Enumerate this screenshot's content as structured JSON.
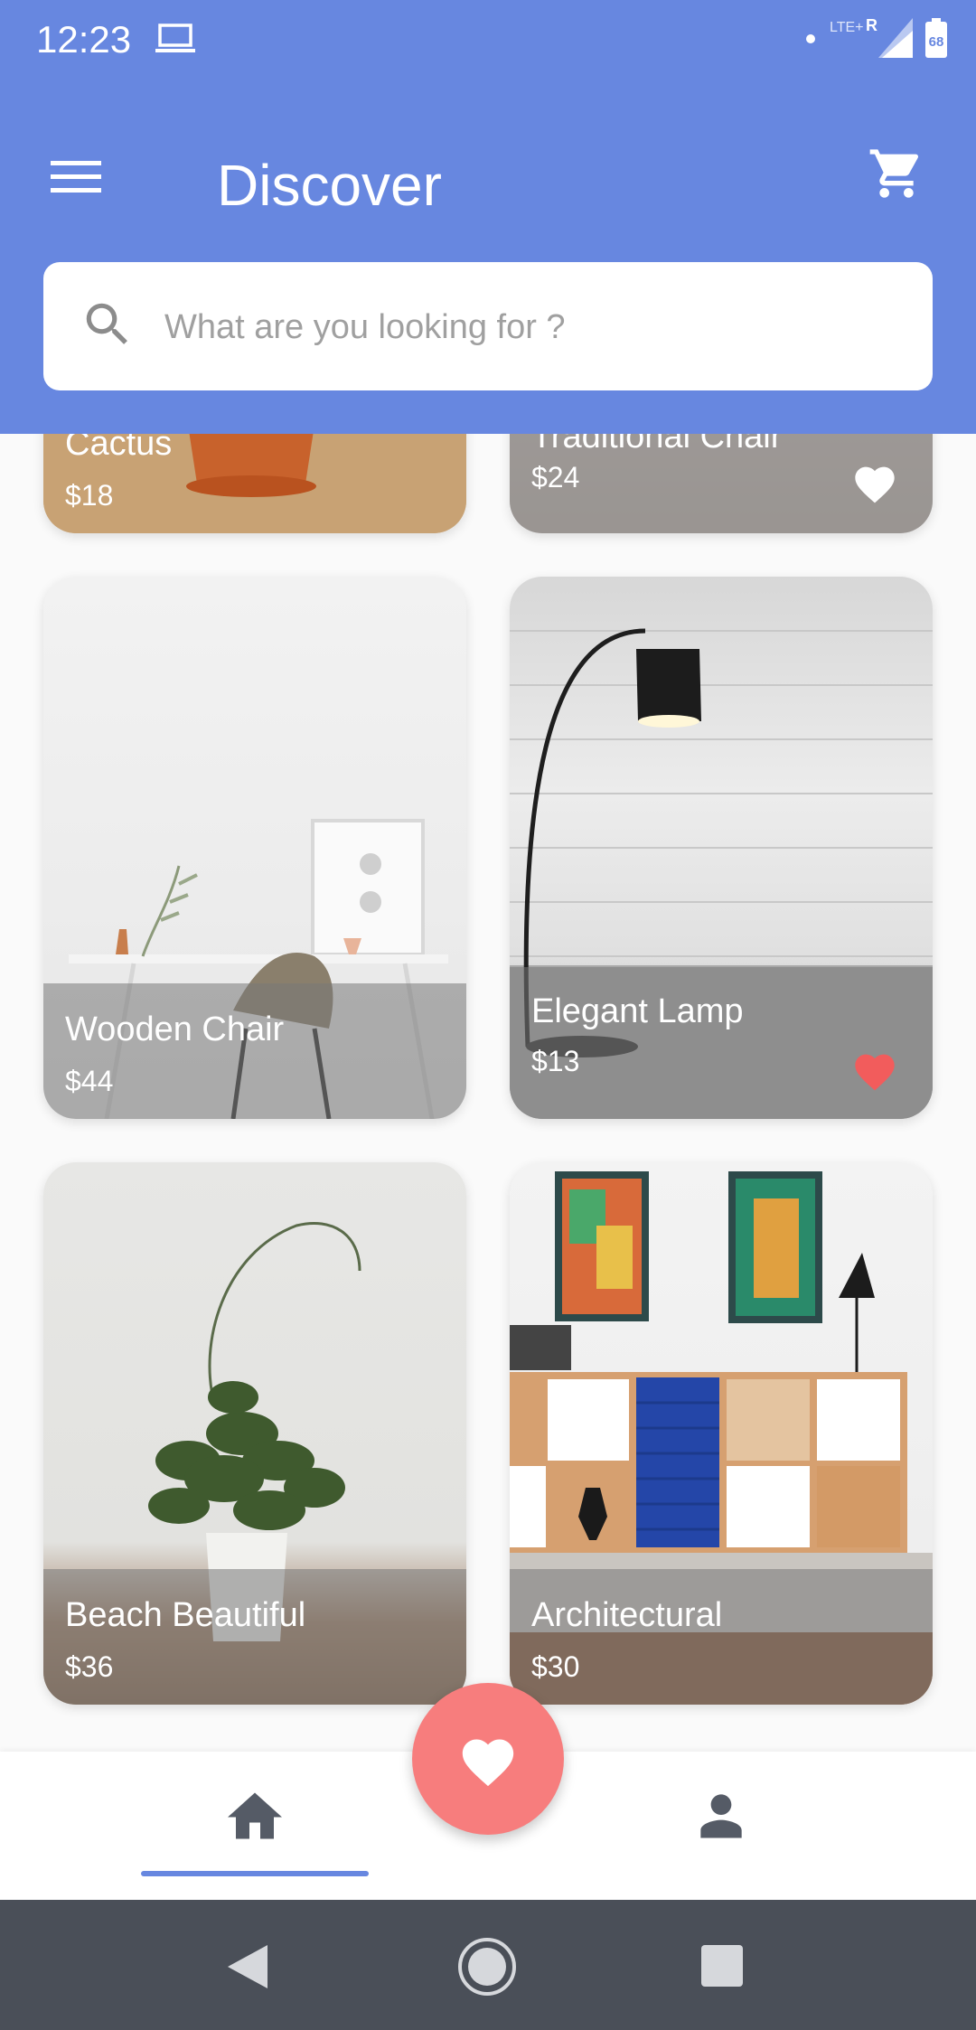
{
  "status_bar": {
    "time": "12:23",
    "network": "LTE+",
    "roaming": "R",
    "battery": "68"
  },
  "header": {
    "title": "Discover",
    "icons": {
      "menu": "hamburger-menu-icon",
      "cart": "shopping-cart-icon"
    }
  },
  "search": {
    "placeholder": "What are you looking for ?",
    "value": "",
    "icon": "search-icon"
  },
  "products": [
    {
      "name": "Cactus",
      "price": "$18",
      "favorite": false
    },
    {
      "name": "Traditional Chair",
      "price": "$24",
      "favorite": true
    },
    {
      "name": "Wooden Chair",
      "price": "$44",
      "favorite": false
    },
    {
      "name": "Elegant Lamp",
      "price": "$13",
      "favorite": true
    },
    {
      "name": "Beach Beautiful",
      "price": "$36",
      "favorite": false
    },
    {
      "name": "Architectural",
      "price": "$30",
      "favorite": false
    }
  ],
  "colors": {
    "primary": "#6787e0",
    "favorite_fab": "#f77d7d",
    "heart_active": "#f25c5c",
    "heart_inactive": "#ffffff",
    "nav_icon": "#555b66"
  },
  "bottom_nav": {
    "items": [
      "home-icon",
      "heart-icon",
      "profile-icon"
    ],
    "active": "home"
  },
  "system_nav": {
    "items": [
      "back-icon",
      "home-icon",
      "recents-icon"
    ]
  }
}
